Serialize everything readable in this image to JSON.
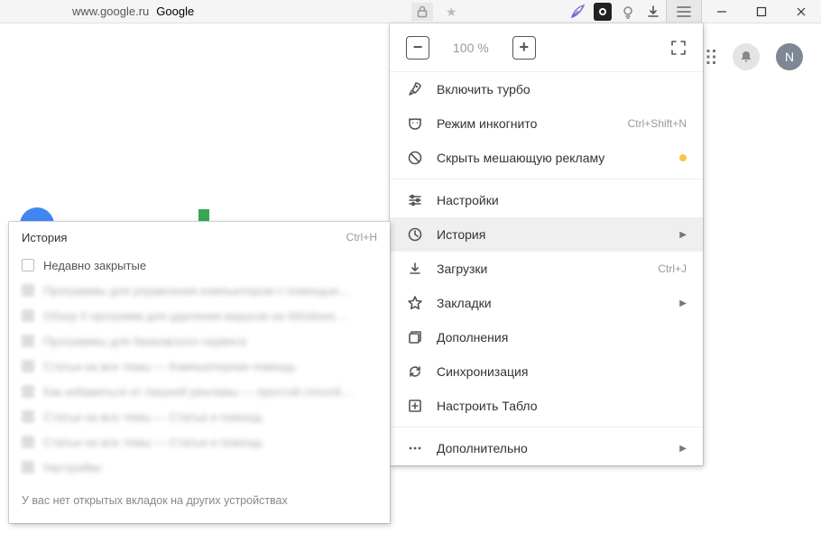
{
  "titlebar": {
    "url_host": "www.google.ru",
    "page_title": "Google"
  },
  "zoom": {
    "value": "100 %"
  },
  "main_menu": {
    "turbo": "Включить турбо",
    "incognito": "Режим инкогнито",
    "incognito_short": "Ctrl+Shift+N",
    "hide_ads": "Скрыть мешающую рекламу",
    "settings": "Настройки",
    "history": "История",
    "downloads": "Загрузки",
    "downloads_short": "Ctrl+J",
    "bookmarks": "Закладки",
    "addons": "Дополнения",
    "sync": "Синхронизация",
    "tableau": "Настроить Табло",
    "more": "Дополнительно"
  },
  "history_panel": {
    "title": "История",
    "shortcut": "Ctrl+H",
    "recently_closed": "Недавно закрытые",
    "footer": "У вас нет открытых вкладок на других устройствах",
    "blurred": [
      "Программы для управления компьютером с помощью…",
      "Обзор 5 программ для удаления вирусов на Windows…",
      "Программы для банковского сервиса",
      "Статьи на все темы — Компьютерная помощь",
      "Как избавиться от лишней рекламы — простой способ…",
      "Статьи на все темы — Статьи и помощь",
      "Статьи на все темы — Статьи и помощь",
      "Настройки"
    ]
  },
  "avatar": {
    "initial": "N"
  }
}
